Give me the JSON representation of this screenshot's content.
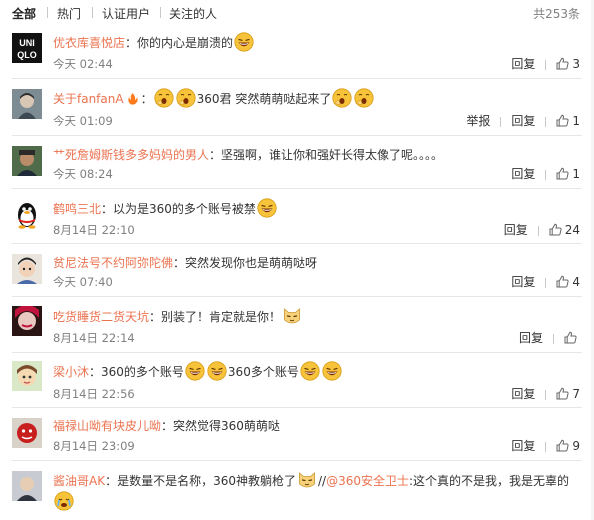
{
  "tabs": [
    "全部",
    "热门",
    "认证用户",
    "关注的人"
  ],
  "total": "共253条",
  "reply_label": "回复",
  "report_label": "举报",
  "comments": [
    {
      "user": "优衣库喜悦店",
      "text_a": "：你的内心是崩溃的",
      "text_b": "",
      "time": "今天 02:44",
      "likes": "3"
    },
    {
      "user": "关于fanfanA",
      "text_a": "360君 突然萌萌哒起来了",
      "text_b": "",
      "time": "今天 01:09",
      "likes": "1"
    },
    {
      "user": "艹死詹姆斯钱多多妈妈的男人",
      "text_a": "：坚强啊，谁让你和强奸长得太像了呢。。。。",
      "text_b": "",
      "time": "今天 08:24",
      "likes": "1"
    },
    {
      "user": "鹤鸣三北",
      "text_a": "：以为是360的多个账号被禁",
      "text_b": "",
      "time": "8月14日 22:10",
      "likes": "24"
    },
    {
      "user": "贫尼法号不约阿弥陀佛",
      "text_a": "：突然发现你也是萌萌哒呀",
      "text_b": "",
      "time": "今天 07:40",
      "likes": "4"
    },
    {
      "user": "吃货睡货二货天坑",
      "text_a": "：别装了！肯定就是你！",
      "text_b": "",
      "time": "8月14日 22:14",
      "likes": ""
    },
    {
      "user": "梁小沐",
      "text_a": "：360的多个账号",
      "text_b": "360多个账号",
      "time": "8月14日 22:56",
      "likes": "7"
    },
    {
      "user": "福禄山呦有块皮儿呦",
      "text_a": "：突然觉得360萌萌哒",
      "text_b": "",
      "time": "8月14日 23:09",
      "likes": "9"
    },
    {
      "user": "酱油哥AK",
      "text_a": "：是数量不是名称，360神教躺枪了",
      "text_b": "//",
      "mention": "@360安全卫士",
      "text_c": ":这个真的不是我，我是无辜的",
      "time": "",
      "likes": ""
    }
  ],
  "colors": {
    "username": "#eb7350",
    "meta": "#808080",
    "divider": "#e6e6e6",
    "emoji": "#f6c33a"
  }
}
